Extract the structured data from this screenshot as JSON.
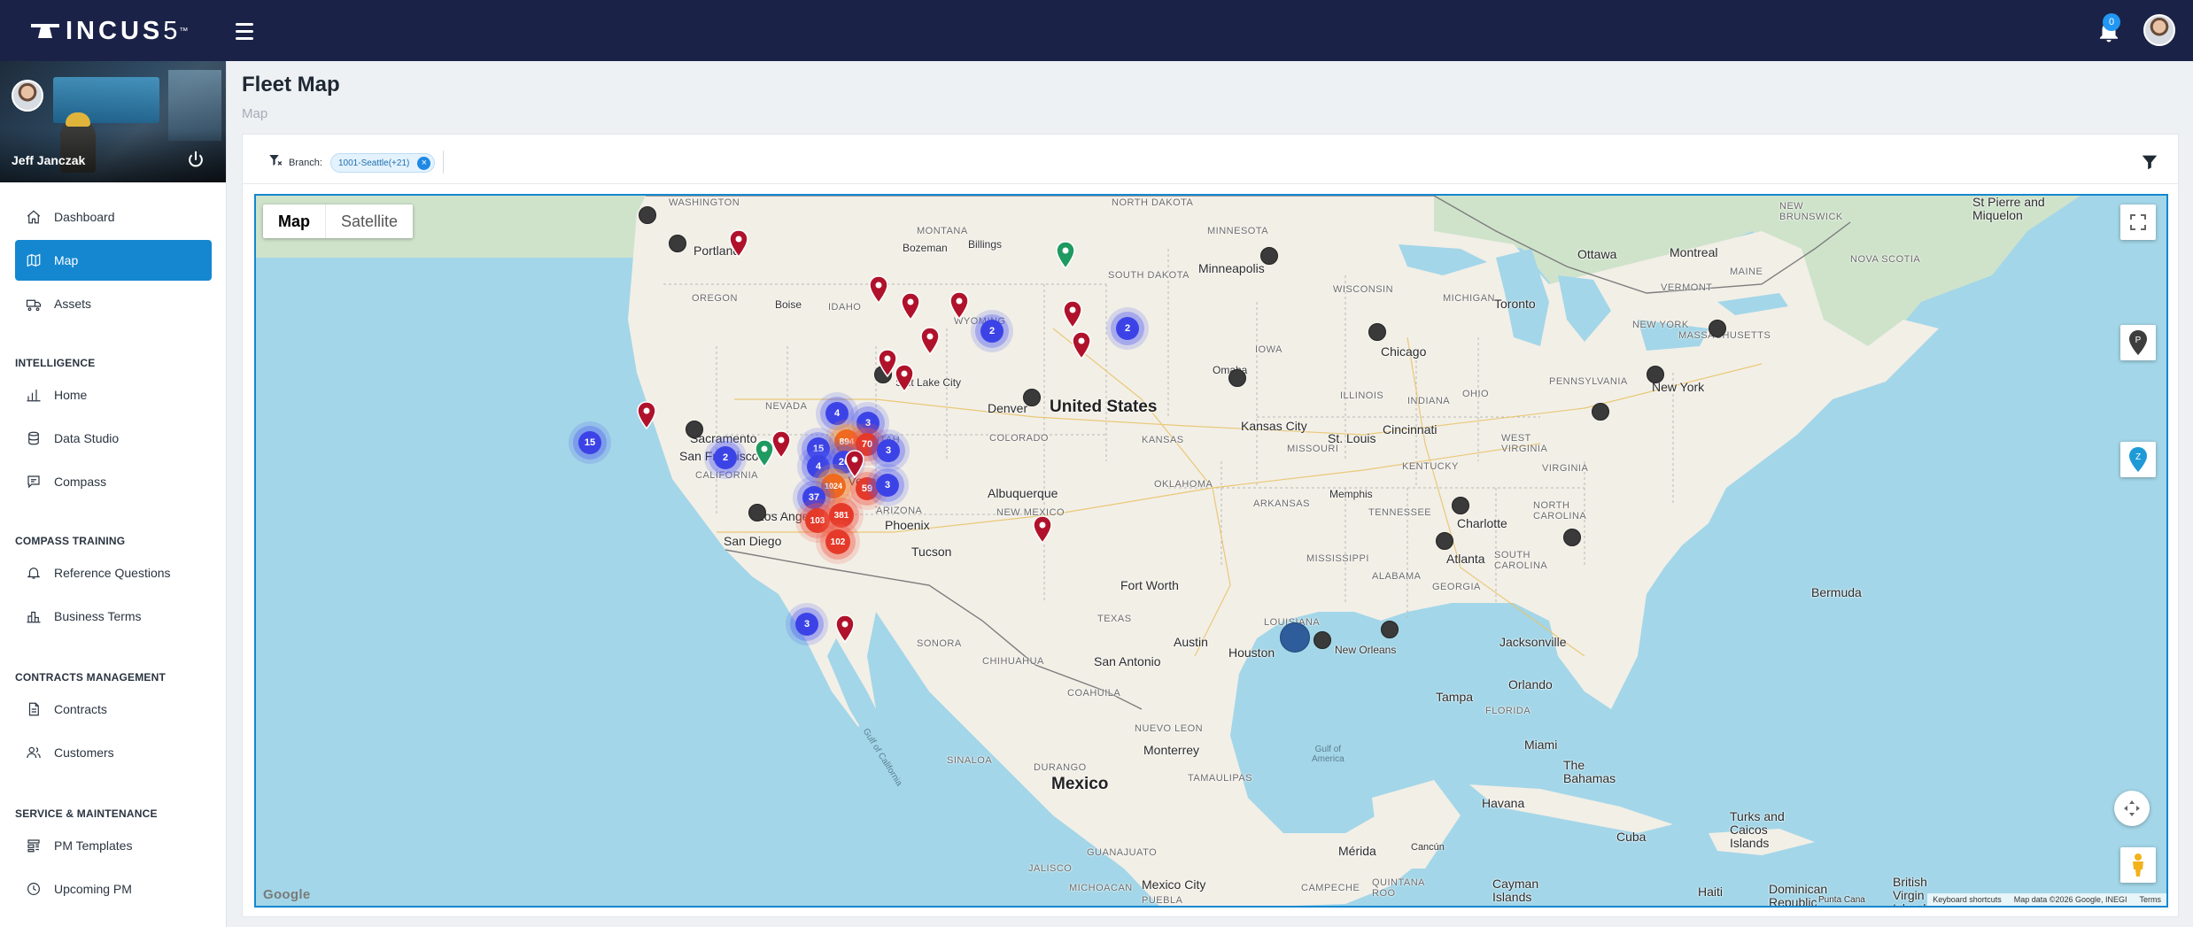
{
  "app": {
    "logo_text": "INCUS",
    "logo_sup": "5",
    "logo_tm": "™",
    "notifications_count": "0"
  },
  "user": {
    "name": "Jeff Janczak"
  },
  "nav": {
    "dashboard": "Dashboard",
    "map": "Map",
    "assets": "Assets",
    "section_intelligence": "INTELLIGENCE",
    "home": "Home",
    "data_studio": "Data Studio",
    "compass": "Compass",
    "section_compass_training": "COMPASS TRAINING",
    "reference_questions": "Reference Questions",
    "business_terms": "Business Terms",
    "section_contracts": "CONTRACTS MANAGEMENT",
    "contracts": "Contracts",
    "customers": "Customers",
    "section_service": "SERVICE & MAINTENANCE",
    "pm_templates": "PM Templates",
    "upcoming_pm": "Upcoming PM"
  },
  "page": {
    "title": "Fleet Map",
    "breadcrumb": "Map"
  },
  "filters": {
    "branch_label": "Branch:",
    "branch_chip": "1001-Seattle(+21)"
  },
  "map": {
    "toggle_map": "Map",
    "toggle_satellite": "Satellite",
    "footer_shortcuts": "Keyboard shortcuts",
    "footer_data": "Map data ©2026 Google, INEGI",
    "footer_terms": "Terms",
    "google": "Google",
    "pin_p": "P",
    "pin_z": "Z",
    "labels": {
      "united_states": "United States",
      "mexico": "Mexico",
      "washington": "WASHINGTON",
      "portland": "Portland",
      "oregon": "OREGON",
      "idaho": "IDAHO",
      "boise": "Boise",
      "montana": "MONTANA",
      "bozeman": "Bozeman",
      "billings": "Billings",
      "wyoming": "WYOMING",
      "south_dakota": "SOUTH DAKOTA",
      "north_dakota": "NORTH DAKOTA",
      "minnesota": "MINNESOTA",
      "minneapolis": "Minneapolis",
      "wisconsin": "WISCONSIN",
      "michigan": "MICHIGAN",
      "iowa": "IOWA",
      "omaha": "Omaha",
      "chicago": "Chicago",
      "nevada": "NEVADA",
      "utah": "UTAH",
      "salt_lake_city": "Salt Lake City",
      "colorado": "COLORADO",
      "denver": "Denver",
      "kansas": "KANSAS",
      "kansas_city": "Kansas City",
      "missouri": "MISSOURI",
      "st_louis": "St. Louis",
      "illinois": "ILLINOIS",
      "indiana": "INDIANA",
      "ohio": "OHIO",
      "cincinnati": "Cincinnati",
      "kentucky": "KENTUCKY",
      "west_virginia": "WEST\nVIRGINIA",
      "virginia": "VIRGINIA",
      "pennsylvania": "PENNSYLVANIA",
      "new_york_state": "NEW YORK",
      "new_york": "New York",
      "toronto": "Toronto",
      "ottawa": "Ottawa",
      "montreal": "Montreal",
      "vermont": "VERMONT",
      "maine": "MAINE",
      "new_brunswick": "NEW\nBRUNSWICK",
      "massachusetts": "MASSACHUSETTS",
      "nova_scotia": "NOVA SCOTIA",
      "st_pierre": "St Pierre and\nMiquelon",
      "sacramento": "Sacramento",
      "san_francisco": "San Francisco",
      "california": "CALIFORNIA",
      "las_vegas": "Las Vegas",
      "arizona": "ARIZONA",
      "phoenix": "Phoenix",
      "tucson": "Tucson",
      "los_angeles": "Los Angeles",
      "san_diego": "San Diego",
      "new_mexico": "NEW MEXICO",
      "albuquerque": "Albuquerque",
      "oklahoma": "OKLAHOMA",
      "arkansas": "ARKANSAS",
      "memphis": "Memphis",
      "tennessee": "TENNESSEE",
      "charlotte": "Charlotte",
      "north_carolina": "NORTH\nCAROLINA",
      "south_carolina": "SOUTH\nCAROLINA",
      "georgia": "GEORGIA",
      "atlanta": "Atlanta",
      "alabama": "ALABAMA",
      "mississippi": "MISSISSIPPI",
      "louisiana": "LOUISIANA",
      "new_orleans": "New Orleans",
      "fort_worth": "Fort Worth",
      "austin": "Austin",
      "houston": "Houston",
      "san_antonio": "San Antonio",
      "texas": "TEXAS",
      "jacksonville": "Jacksonville",
      "orlando": "Orlando",
      "tampa": "Tampa",
      "miami": "Miami",
      "florida": "FLORIDA",
      "bermuda": "Bermuda",
      "the_bahamas": "The\nBahamas",
      "havana": "Havana",
      "cuba": "Cuba",
      "turks": "Turks and\nCaicos\nIslands",
      "cayman": "Cayman\nIslands",
      "haiti": "Haiti",
      "dominican": "Dominican\nRepublic",
      "bvi": "British\nVirgin\nIslands",
      "gulf_mexico": "Gulf of\nAmerica",
      "gulf_california": "Gulf of California",
      "sonora": "SONORA",
      "chihuahua": "CHIHUAHUA",
      "coahuila": "COAHUILA",
      "nuevo_leon": "NUEVO LEON",
      "tamaulipas": "TAMAULIPAS",
      "monterrey": "Monterrey",
      "durango": "DURANGO",
      "sinaloa": "SINALOA",
      "jalisco": "JALISCO",
      "guanajuato": "GUANAJUATO",
      "michoacan": "MICHOACAN",
      "mexico_city": "Mexico City",
      "merida": "Mérida",
      "cancun": "Cancún",
      "campeche": "CAMPECHE",
      "quintana_roo": "QUINTANA\nROO",
      "puebla": "PUEBLA",
      "punta_cana": "Punta Cana"
    },
    "clusters": [
      {
        "id": "c15-sd",
        "count": "15",
        "color": "blue"
      },
      {
        "id": "c2-elpaso",
        "count": "2",
        "color": "blue"
      },
      {
        "id": "c4-ok",
        "count": "4",
        "color": "blue"
      },
      {
        "id": "c3-ar",
        "count": "3",
        "color": "blue"
      },
      {
        "id": "c894",
        "count": "894",
        "color": "orange"
      },
      {
        "id": "c70",
        "count": "70",
        "color": "red"
      },
      {
        "id": "c15-fw",
        "count": "15",
        "color": "blue"
      },
      {
        "id": "c3-la",
        "count": "3",
        "color": "blue"
      },
      {
        "id": "c4-tx",
        "count": "4",
        "color": "blue"
      },
      {
        "id": "c26",
        "count": "26",
        "color": "blue"
      },
      {
        "id": "c1024",
        "count": "1024",
        "color": "orange"
      },
      {
        "id": "c59",
        "count": "59",
        "color": "red"
      },
      {
        "id": "c3-hou",
        "count": "3",
        "color": "blue"
      },
      {
        "id": "c37",
        "count": "37",
        "color": "blue"
      },
      {
        "id": "c103",
        "count": "103",
        "color": "red"
      },
      {
        "id": "c381",
        "count": "381",
        "color": "red"
      },
      {
        "id": "c102",
        "count": "102",
        "color": "red"
      },
      {
        "id": "c2-cin",
        "count": "2",
        "color": "blue"
      },
      {
        "id": "c2-ne",
        "count": "2",
        "color": "blue"
      },
      {
        "id": "c3-mx",
        "count": "3",
        "color": "blue"
      }
    ]
  },
  "colors": {
    "topbar": "#1b2247",
    "accent": "#1487d0",
    "pin_red": "#b0122b",
    "pin_green": "#1f9a60"
  }
}
